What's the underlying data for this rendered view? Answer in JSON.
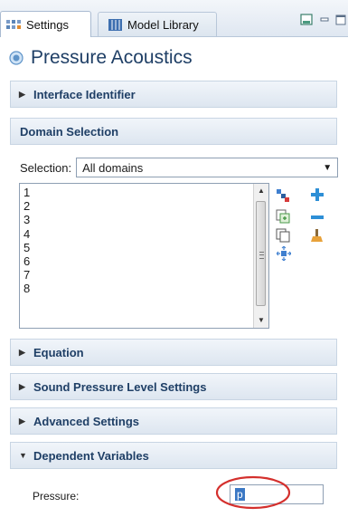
{
  "tabs": [
    {
      "label": "Settings",
      "active": true,
      "icon": "settings-icon"
    },
    {
      "label": "Model Library",
      "active": false,
      "icon": "library-icon"
    }
  ],
  "window_controls": [
    "restore-view-icon",
    "minimize-icon",
    "maximize-icon"
  ],
  "title": "Pressure Acoustics",
  "sections": {
    "interface_identifier": "Interface Identifier",
    "domain_selection": "Domain Selection",
    "equation": "Equation",
    "sound_pressure": "Sound Pressure Level Settings",
    "advanced": "Advanced Settings",
    "dependent_variables": "Dependent Variables"
  },
  "selection": {
    "label": "Selection:",
    "value": "All domains"
  },
  "domains": [
    "1",
    "2",
    "3",
    "4",
    "5",
    "6",
    "7",
    "8"
  ],
  "selection_tools": [
    "select-domains-icon",
    "add-icon",
    "paste-selection-icon",
    "remove-icon",
    "copy-selection-icon",
    "clear-selection-icon",
    "zoom-to-selection-icon"
  ],
  "pressure": {
    "label": "Pressure:",
    "value": "p"
  },
  "colors": {
    "title": "#1f3f66",
    "highlight_circle": "#d4302d",
    "input_selection": "#3b78c4"
  }
}
